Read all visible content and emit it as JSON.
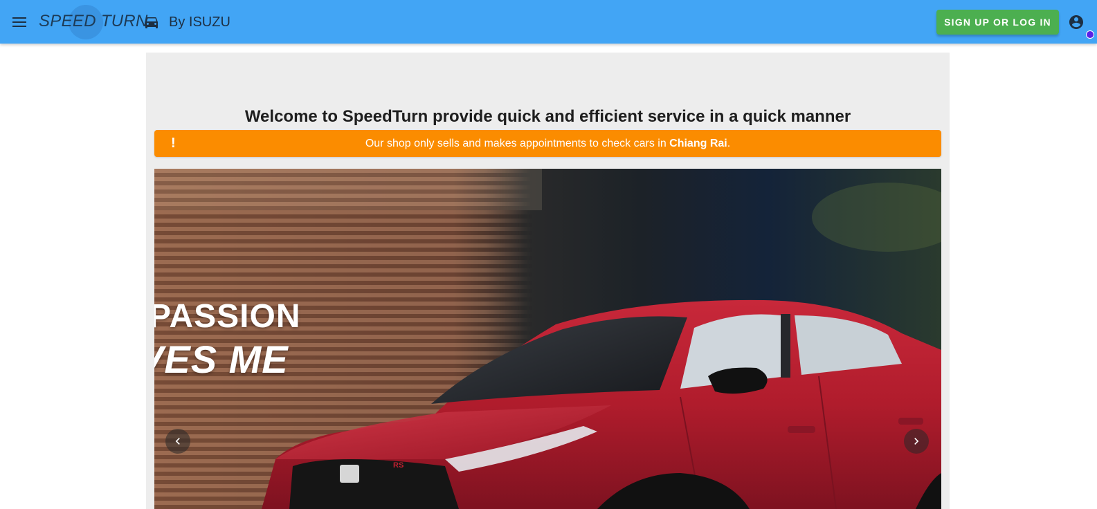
{
  "header": {
    "brand": "SPEED TURN",
    "byline": "By ISUZU",
    "signup_label": "SIGN UP OR LOG IN",
    "menu_icon": "menu-icon",
    "car_icon": "car-icon",
    "account_icon": "account-circle-icon",
    "bar_color": "#42a5f5",
    "signup_color": "#4caf50"
  },
  "main": {
    "welcome": "Welcome to SpeedTurn provide quick and efficient service in a quick manner",
    "alert": {
      "icon": "!",
      "text_before": "Our shop only sells and makes appointments to check cars in ",
      "text_bold": "Chiang Rai",
      "text_after": ".",
      "color": "#fb8c00"
    },
    "carousel": {
      "slide_line1": "PASSION",
      "slide_line2": "VES ME",
      "prev_icon": "chevron-left-icon",
      "next_icon": "chevron-right-icon"
    }
  }
}
